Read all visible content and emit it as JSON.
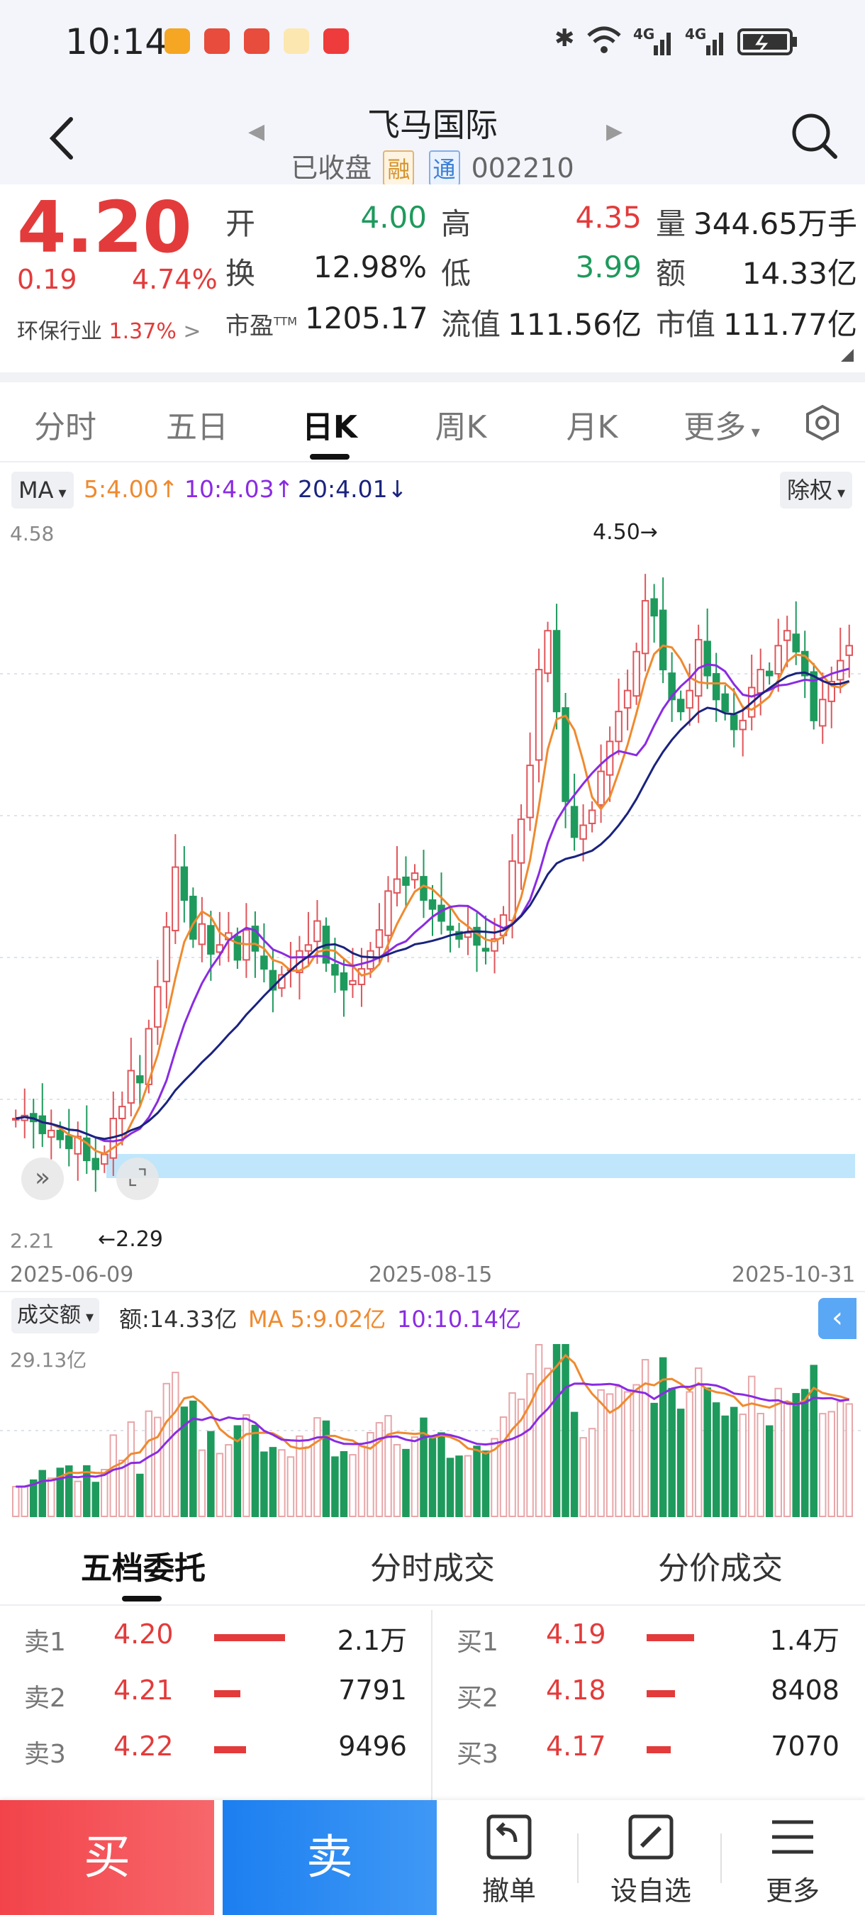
{
  "status_bar": {
    "time": "10:14",
    "network_1": "4G",
    "network_2": "4G"
  },
  "header": {
    "stock_name": "飞马国际",
    "market_status": "已收盘",
    "tag_margin": "融",
    "tag_connect": "通",
    "stock_code": "002210"
  },
  "quote": {
    "price": "4.20",
    "change": "0.19",
    "change_pct": "4.74%",
    "industry_label": "环保行业",
    "industry_pct": "1.37%",
    "open_label": "开",
    "open": "4.00",
    "high_label": "高",
    "high": "4.35",
    "volume_label": "量",
    "volume": "344.65万手",
    "turnover_label": "换",
    "turnover": "12.98%",
    "low_label": "低",
    "low": "3.99",
    "amount_label": "额",
    "amount": "14.33亿",
    "pe_label": "市盈",
    "pe_sup": "TTM",
    "pe": "1205.17",
    "float_cap_label": "流值",
    "float_cap": "111.56亿",
    "total_cap_label": "市值",
    "total_cap": "111.77亿"
  },
  "period_tabs": [
    "分时",
    "五日",
    "日K",
    "周K",
    "月K",
    "更多"
  ],
  "ma_legend": {
    "button": "MA",
    "ma5": "5:4.00↑",
    "ma10": "10:4.03↑",
    "ma20": "20:4.01↓",
    "adjust_button": "除权"
  },
  "chart_data": {
    "type": "candlestick",
    "x_start": "2025-06-09",
    "x_mid": "2025-08-15",
    "x_end": "2025-10-31",
    "y_max_label": "4.58",
    "y_min_label": "2.21",
    "ylim": [
      2.21,
      4.58
    ],
    "high_annotation": "4.50→",
    "low_annotation": "←2.29",
    "close_path": [
      2.62,
      2.63,
      2.61,
      2.57,
      2.58,
      2.55,
      2.52,
      2.56,
      2.48,
      2.45,
      2.5,
      2.62,
      2.66,
      2.78,
      2.74,
      2.92,
      3.06,
      3.26,
      3.46,
      3.35,
      3.22,
      3.27,
      3.17,
      3.2,
      3.24,
      3.15,
      3.25,
      3.18,
      3.12,
      3.05,
      3.1,
      3.12,
      3.18,
      3.2,
      3.28,
      3.14,
      3.1,
      3.05,
      3.08,
      3.12,
      3.18,
      3.25,
      3.38,
      3.42,
      3.4,
      3.44,
      3.35,
      3.32,
      3.28,
      3.25,
      3.22,
      3.24,
      3.2,
      3.18,
      3.22,
      3.3,
      3.48,
      3.62,
      3.8,
      4.12,
      4.25,
      3.98,
      3.68,
      3.56,
      3.6,
      3.65,
      3.78,
      3.88,
      3.98,
      4.05,
      4.18,
      4.35,
      4.3,
      4.12,
      4.02,
      3.98,
      4.05,
      4.22,
      4.1,
      4.02,
      3.98,
      3.92,
      3.95,
      4.06,
      4.12,
      4.1,
      4.2,
      4.25,
      4.18,
      4.1,
      3.95,
      4.02,
      4.08,
      4.15,
      4.2
    ],
    "ma5": "4.00",
    "ma10": "4.03",
    "ma20": "4.01"
  },
  "volume_panel": {
    "button": "成交额",
    "amount": "额:14.33亿",
    "ma5": "MA 5:9.02亿",
    "ma10": "10:10.14亿",
    "y_max_label": "29.13亿"
  },
  "orderbook": {
    "tabs": [
      "五档委托",
      "分时成交",
      "分价成交"
    ],
    "sell": [
      {
        "label": "卖1",
        "price": "4.20",
        "volume": "2.1万",
        "bar": 1.0
      },
      {
        "label": "卖2",
        "price": "4.21",
        "volume": "7791",
        "bar": 0.37
      },
      {
        "label": "卖3",
        "price": "4.22",
        "volume": "9496",
        "bar": 0.45
      }
    ],
    "buy": [
      {
        "label": "买1",
        "price": "4.19",
        "volume": "1.4万",
        "bar": 0.67
      },
      {
        "label": "买2",
        "price": "4.18",
        "volume": "8408",
        "bar": 0.4
      },
      {
        "label": "买3",
        "price": "4.17",
        "volume": "7070",
        "bar": 0.34
      }
    ]
  },
  "bottom_bar": {
    "buy": "买",
    "sell": "卖",
    "cancel": "撤单",
    "watchlist": "设自选",
    "more": "更多"
  }
}
